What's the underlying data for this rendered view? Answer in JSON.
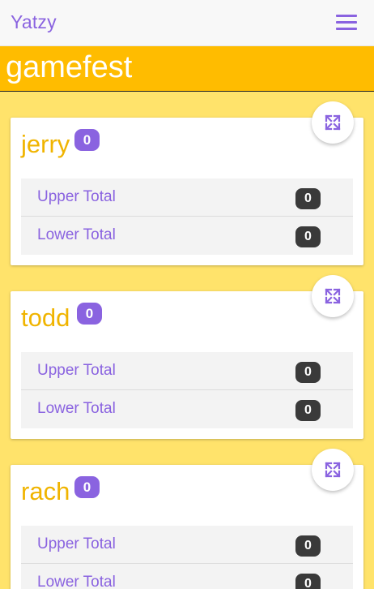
{
  "app": {
    "title": "Yatzy",
    "menu_icon": "hamburger-menu-icon"
  },
  "game": {
    "name": "gamefest"
  },
  "players": [
    {
      "name": "jerry",
      "score": "0",
      "totals": [
        {
          "label": "Upper Total",
          "value": "0"
        },
        {
          "label": "Lower Total",
          "value": "0"
        }
      ]
    },
    {
      "name": "todd",
      "score": "0",
      "totals": [
        {
          "label": "Upper Total",
          "value": "0"
        },
        {
          "label": "Lower Total",
          "value": "0"
        }
      ]
    },
    {
      "name": "rach",
      "score": "0",
      "totals": [
        {
          "label": "Upper Total",
          "value": "0"
        },
        {
          "label": "Lower Total",
          "value": "0"
        }
      ]
    }
  ],
  "colors": {
    "accent": "#8a63e0",
    "banner": "#ffbc00",
    "background": "#ffe36b",
    "player_name": "#f0b400"
  }
}
